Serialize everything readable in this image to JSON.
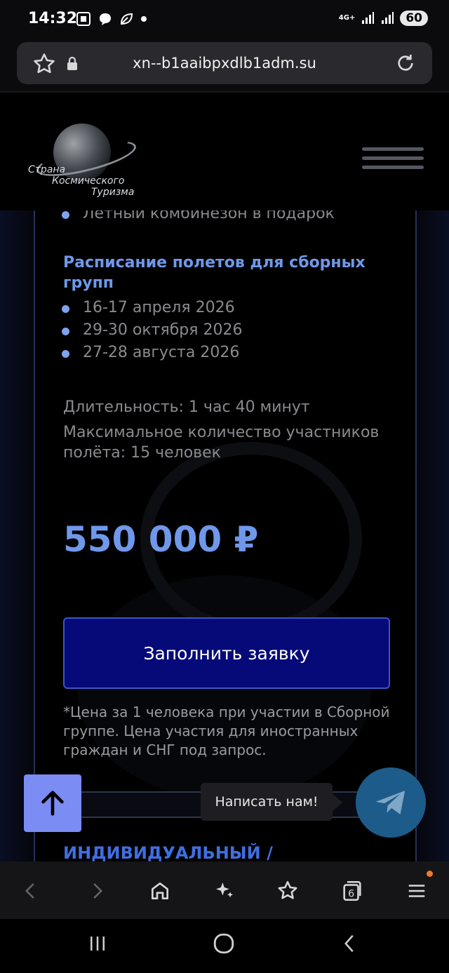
{
  "status_bar": {
    "time": "14:32",
    "network": "4G+",
    "battery": "60"
  },
  "browser": {
    "url": "xn--b1aaibpxdlb1adm.su",
    "tabs_count": "6"
  },
  "logo": {
    "line1": "Страна",
    "line2": "Космического",
    "line3": "Туризма"
  },
  "content": {
    "bullet_top": "Летный комбинезон в подарок",
    "schedule_title": "Расписание полетов для сборных групп",
    "schedule_dates": [
      "16-17 апреля 2026",
      "29-30 октября 2026",
      "27-28 августа 2026"
    ],
    "duration": "Длительность: 1 час 40 минут",
    "max_participants": "Максимальное количество участников полёта: 15 человек",
    "price": "550 000 ₽",
    "cta_label": "Заполнить заявку",
    "note": "*Цена за 1 человека при участии в Сборной группе. Цена участия для иностранных граждан и СНГ под запрос.",
    "next_section": "ИНДИВИДУАЛЬНЫЙ /"
  },
  "floating": {
    "tooltip": "Написать нам!"
  },
  "colors": {
    "accent": "#6f98ea",
    "cta": "#050a78",
    "telegram": "#1d5c8a",
    "scroll_up": "#7b8cf5"
  }
}
